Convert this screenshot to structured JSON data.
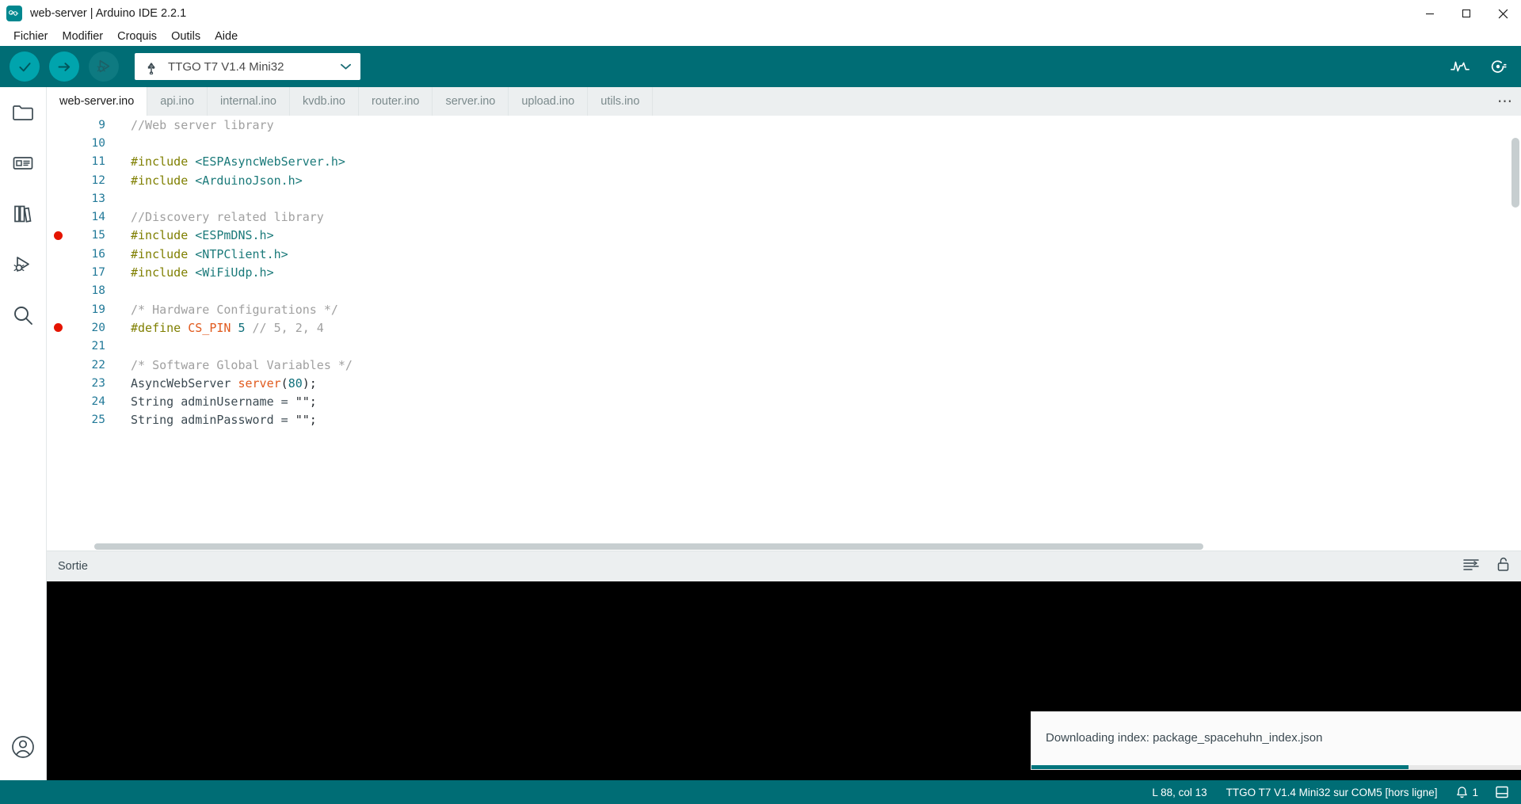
{
  "window": {
    "title": "web-server | Arduino IDE 2.2.1",
    "logo_icon": "arduino-infinity-icon",
    "minimize_icon": "minimize-icon",
    "maximize_icon": "maximize-icon",
    "close_icon": "close-icon",
    "accent_color": "#006D75",
    "toolbar_button_color": "#00A4AD"
  },
  "menubar": {
    "items": [
      {
        "label": "Fichier"
      },
      {
        "label": "Modifier"
      },
      {
        "label": "Croquis"
      },
      {
        "label": "Outils"
      },
      {
        "label": "Aide"
      }
    ]
  },
  "toolbar": {
    "verify_label": "Vérifier",
    "verify_icon": "checkmark-icon",
    "upload_label": "Téléverser",
    "upload_icon": "arrow-right-icon",
    "debug_label": "Déboguer",
    "debug_icon": "debug-icon",
    "board_selector": {
      "usb_icon": "usb-icon",
      "value": "TTGO T7 V1.4 Mini32",
      "caret_icon": "chevron-down-icon"
    },
    "serial_plotter_icon": "serial-plotter-icon",
    "serial_monitor_icon": "serial-monitor-icon"
  },
  "activity_bar": {
    "items": [
      {
        "name": "sketchbook",
        "icon": "folder-icon"
      },
      {
        "name": "boards-manager",
        "icon": "board-icon"
      },
      {
        "name": "library-manager",
        "icon": "books-icon"
      },
      {
        "name": "debug",
        "icon": "debug-play-icon"
      },
      {
        "name": "search",
        "icon": "search-icon"
      }
    ],
    "account": {
      "name": "account",
      "icon": "user-circle-icon"
    }
  },
  "tabs": {
    "items": [
      {
        "label": "web-server.ino",
        "active": true
      },
      {
        "label": "api.ino",
        "active": false
      },
      {
        "label": "internal.ino",
        "active": false
      },
      {
        "label": "kvdb.ino",
        "active": false
      },
      {
        "label": "router.ino",
        "active": false
      },
      {
        "label": "server.ino",
        "active": false
      },
      {
        "label": "upload.ino",
        "active": false
      },
      {
        "label": "utils.ino",
        "active": false
      }
    ],
    "overflow_label": "⋯"
  },
  "editor": {
    "lines": [
      {
        "no": "9",
        "bp": false,
        "tokens": [
          {
            "t": "//Web server library",
            "c": "c-comment"
          }
        ]
      },
      {
        "no": "10",
        "bp": false,
        "tokens": []
      },
      {
        "no": "11",
        "bp": false,
        "tokens": [
          {
            "t": "#include ",
            "c": "c-pre"
          },
          {
            "t": "<ESPAsyncWebServer.h>",
            "c": "c-header"
          }
        ]
      },
      {
        "no": "12",
        "bp": false,
        "tokens": [
          {
            "t": "#include ",
            "c": "c-pre"
          },
          {
            "t": "<ArduinoJson.h>",
            "c": "c-header"
          }
        ]
      },
      {
        "no": "13",
        "bp": false,
        "tokens": []
      },
      {
        "no": "14",
        "bp": false,
        "tokens": [
          {
            "t": "//Discovery related library",
            "c": "c-comment"
          }
        ]
      },
      {
        "no": "15",
        "bp": true,
        "tokens": [
          {
            "t": "#include ",
            "c": "c-pre"
          },
          {
            "t": "<ESPmDNS.h>",
            "c": "c-header"
          }
        ]
      },
      {
        "no": "16",
        "bp": false,
        "tokens": [
          {
            "t": "#include ",
            "c": "c-pre"
          },
          {
            "t": "<NTPClient.h>",
            "c": "c-header"
          }
        ]
      },
      {
        "no": "17",
        "bp": false,
        "tokens": [
          {
            "t": "#include ",
            "c": "c-pre"
          },
          {
            "t": "<WiFiUdp.h>",
            "c": "c-header"
          }
        ]
      },
      {
        "no": "18",
        "bp": false,
        "tokens": []
      },
      {
        "no": "19",
        "bp": false,
        "tokens": [
          {
            "t": "/* Hardware Configurations */",
            "c": "c-comment"
          }
        ]
      },
      {
        "no": "20",
        "bp": true,
        "tokens": [
          {
            "t": "#define ",
            "c": "c-pre"
          },
          {
            "t": "CS_PIN",
            "c": "c-macro"
          },
          {
            "t": " ",
            "c": "c-plain"
          },
          {
            "t": "5",
            "c": "c-num"
          },
          {
            "t": " ",
            "c": "c-plain"
          },
          {
            "t": "// 5, 2, 4",
            "c": "c-comment"
          }
        ]
      },
      {
        "no": "21",
        "bp": false,
        "tokens": []
      },
      {
        "no": "22",
        "bp": false,
        "tokens": [
          {
            "t": "/* Software Global Variables */",
            "c": "c-comment"
          }
        ]
      },
      {
        "no": "23",
        "bp": false,
        "tokens": [
          {
            "t": "AsyncWebServer ",
            "c": "c-type"
          },
          {
            "t": "server",
            "c": "c-func"
          },
          {
            "t": "(",
            "c": "c-plain"
          },
          {
            "t": "80",
            "c": "c-num"
          },
          {
            "t": ");",
            "c": "c-plain"
          }
        ]
      },
      {
        "no": "24",
        "bp": false,
        "tokens": [
          {
            "t": "String adminUsername = ",
            "c": "c-type"
          },
          {
            "t": "\"\"",
            "c": "c-str"
          },
          {
            "t": ";",
            "c": "c-plain"
          }
        ]
      },
      {
        "no": "25",
        "bp": false,
        "tokens": [
          {
            "t": "String adminPassword = ",
            "c": "c-type"
          },
          {
            "t": "\"\"",
            "c": "c-str"
          },
          {
            "t": ";",
            "c": "c-plain"
          }
        ]
      }
    ]
  },
  "output": {
    "title": "Sortie",
    "wrap_icon": "toggle-word-wrap-icon",
    "lock_icon": "unlock-autoscroll-icon",
    "console_text": ""
  },
  "toast": {
    "message": "Downloading index: package_spacehuhn_index.json",
    "progress_percent": 77,
    "progress_color": "#00757d"
  },
  "statusbar": {
    "cursor_position": "L 88, col 13",
    "board_status": "TTGO T7 V1.4 Mini32 sur COM5 [hors ligne]",
    "notifications_icon": "bell-icon",
    "notifications_count": "1",
    "layout_icon": "toggle-panel-icon"
  }
}
